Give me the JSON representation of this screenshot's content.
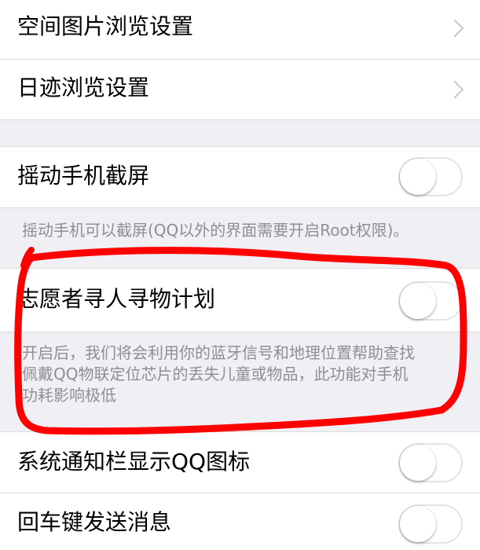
{
  "settings": {
    "photo_browse": {
      "label": "空间图片浏览设置"
    },
    "diary_browse": {
      "label": "日迹浏览设置"
    },
    "shake_screenshot": {
      "label": "摇动手机截屏",
      "enabled": false,
      "description": "摇动手机可以截屏(QQ以外的界面需要开启Root权限)。"
    },
    "volunteer_search": {
      "label": "志愿者寻人寻物计划",
      "enabled": false,
      "description_lines": [
        "开启后，我们将会利用你的蓝牙信号和地理位置帮助查找",
        "佩戴QQ物联定位芯片的丢失儿童或物品，此功能对手机",
        "功耗影响极低"
      ]
    },
    "notification_icon": {
      "label": "系统通知栏显示QQ图标",
      "enabled": false
    },
    "enter_to_send": {
      "label": "回车键发送消息",
      "enabled": false
    }
  },
  "colors": {
    "background": "#efeff4",
    "annotation": "#ff0000"
  }
}
